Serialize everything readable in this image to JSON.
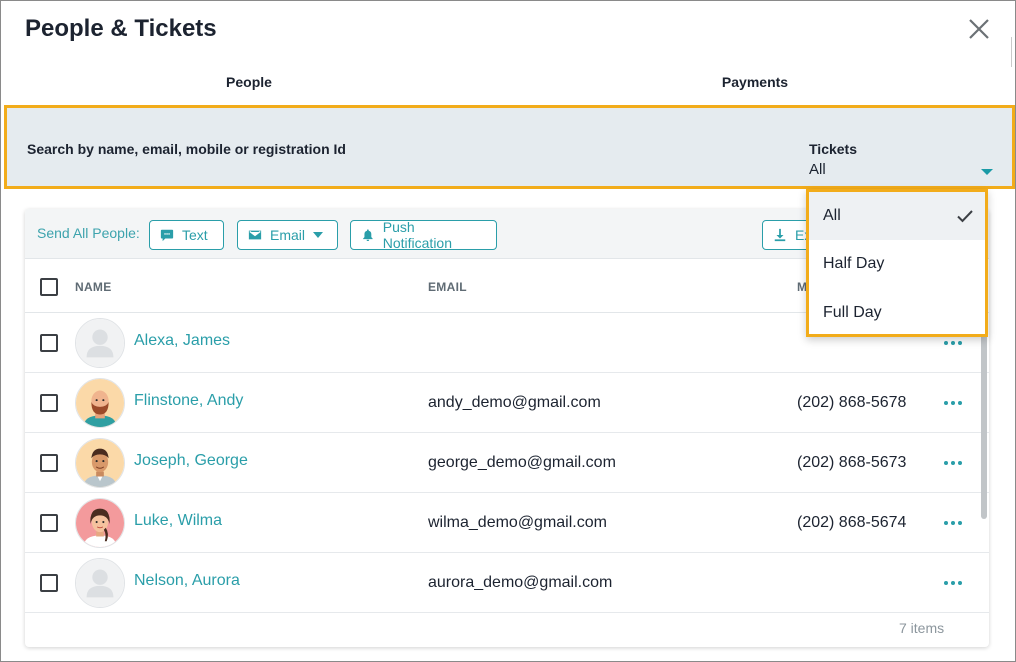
{
  "dialog": {
    "title": "People & Tickets"
  },
  "tabs": [
    {
      "label": "People"
    },
    {
      "label": "Payments"
    }
  ],
  "filters": {
    "search_label": "Search by name, email, mobile or registration Id",
    "tickets_label": "Tickets",
    "tickets_value": "All",
    "options": [
      {
        "label": "All",
        "selected": true
      },
      {
        "label": "Half Day",
        "selected": false
      },
      {
        "label": "Full Day",
        "selected": false
      }
    ]
  },
  "toolbar": {
    "send_all_label": "Send All People:",
    "text_button": "Text",
    "email_button": "Email",
    "push_button": "Push Notification",
    "export_button": "Ex"
  },
  "table": {
    "columns": {
      "name": "NAME",
      "email": "EMAIL",
      "mobile": "M"
    },
    "rows": [
      {
        "name": "Alexa, James",
        "email": "",
        "phone": "",
        "avatar": "placeholder-avatar"
      },
      {
        "name": "Flinstone, Andy",
        "email": "andy_demo@gmail.com",
        "phone": "(202) 868-5678",
        "avatar": "bearded-man-avatar"
      },
      {
        "name": "Joseph, George",
        "email": "george_demo@gmail.com",
        "phone": "(202) 868-5673",
        "avatar": "man-avatar"
      },
      {
        "name": "Luke, Wilma",
        "email": "wilma_demo@gmail.com",
        "phone": "(202) 868-5674",
        "avatar": "woman-avatar"
      },
      {
        "name": "Nelson, Aurora",
        "email": "aurora_demo@gmail.com",
        "phone": "",
        "avatar": "placeholder-avatar"
      }
    ],
    "item_count": "7 items"
  },
  "colors": {
    "accent": "#2a9ea9",
    "highlight": "#f2ac1a",
    "filter_bg": "#e5ebef"
  }
}
